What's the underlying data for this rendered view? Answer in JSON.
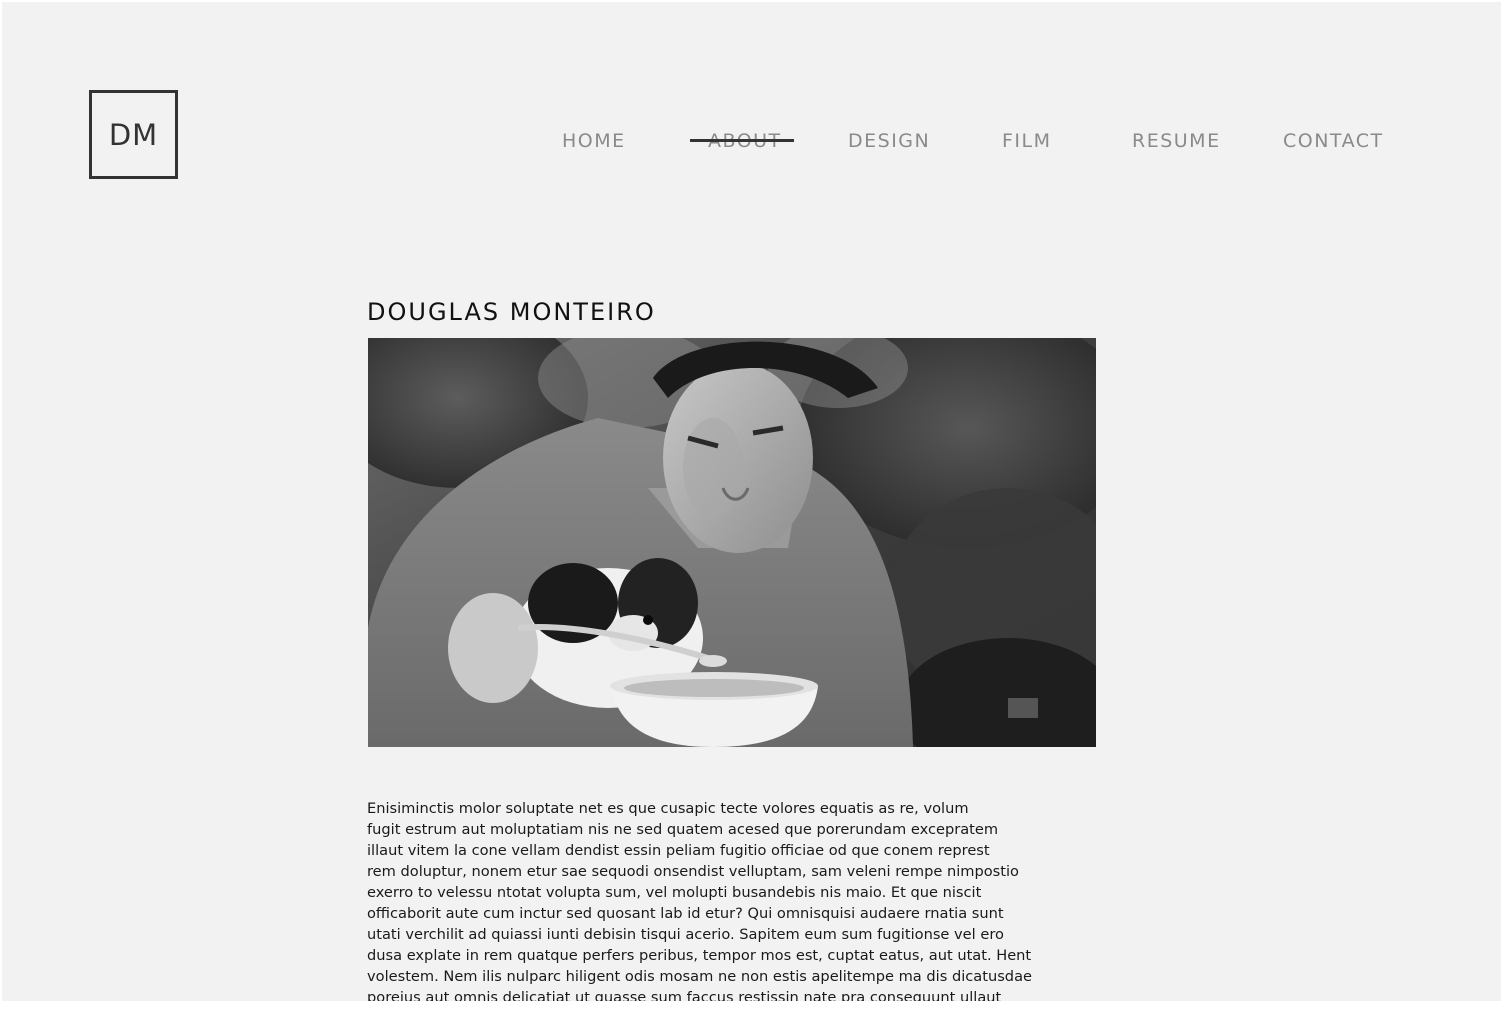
{
  "header": {
    "logo_text": "DM"
  },
  "nav": {
    "items": [
      {
        "label": "HOME"
      },
      {
        "label": "ABOUT",
        "active": true
      },
      {
        "label": "DESIGN"
      },
      {
        "label": "FILM"
      },
      {
        "label": "RESUME"
      },
      {
        "label": "CONTACT"
      }
    ]
  },
  "main": {
    "title": "DOUGLAS MONTEIRO",
    "photo_icon": "black-and-white-photo",
    "bio_lines": [
      "Enisiminctis molor soluptate net es que cusapic tecte volores equatis as re, volum",
      "fugit estrum aut moluptatiam nis ne sed quatem acesed que porerundam excepratem",
      "illaut vitem la cone vellam dendist essin peliam fugitio officiae od que conem represt",
      "rem doluptur, nonem etur sae sequodi onsendist velluptam, sam veleni rempe nimpostio",
      "exerro to velessu ntotat volupta sum, vel molupti busandebis nis maio. Et que niscit",
      "officaborit aute cum inctur sed quosant lab id etur? Qui omnisquisi audaere rnatia sunt",
      "utati verchilit ad quiassi iunti debisin tisqui acerio. Sapitem eum sum fugitionse vel ero",
      "dusa explate in rem quatque perfers peribus, tempor mos est, cuptat eatus, aut utat. Hent",
      "volestem. Nem ilis nulparc hiligent odis mosam ne non estis apelitempe ma dis dicatusdae",
      "poreius aut omnis delicatiat ut quasse sum faccus restissin nate pra consequunt ullaut"
    ]
  },
  "colors": {
    "background": "#f2f2f2",
    "nav_text": "#8a8a8a",
    "dark": "#333333"
  }
}
